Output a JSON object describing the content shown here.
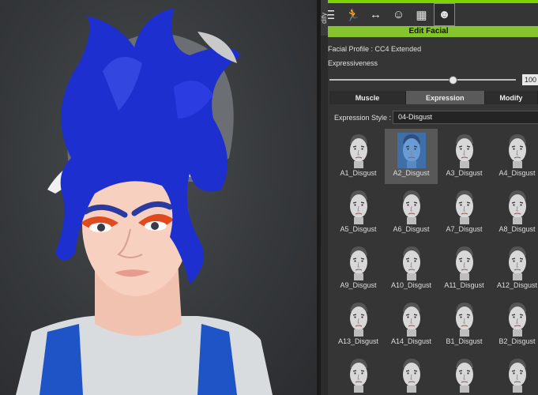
{
  "panel": {
    "side_tab_label": "dify",
    "header_title": "Edit Facial",
    "facial_profile_label": "Facial Profile :",
    "facial_profile_value": "CC4 Extended",
    "expressiveness_label": "Expressiveness",
    "expressiveness_value": "100",
    "expressiveness_level": 0.66,
    "tabs": [
      "Muscle",
      "Expression",
      "Modify"
    ],
    "active_tab": 1,
    "expression_style_label": "Expression Style :",
    "expression_style_value": "04-Disgust",
    "toolbar_icons": [
      "sliders-icon",
      "running-figure-icon",
      "motion-adjust-icon",
      "face-puppet-icon",
      "checker-icon",
      "face-profile-icon"
    ],
    "active_tool": 5,
    "colors": {
      "accent_green": "#86c42d",
      "selected_thumb": "#3e6fa8"
    }
  },
  "expressions": [
    "A1_Disgust",
    "A2_Disgust",
    "A3_Disgust",
    "A4_Disgust",
    "A5_Disgust",
    "A6_Disgust",
    "A7_Disgust",
    "A8_Disgust",
    "A9_Disgust",
    "A10_Disgust",
    "A11_Disgust",
    "A12_Disgust",
    "A13_Disgust",
    "A14_Disgust",
    "B1_Disgust",
    "B2_Disgust",
    "",
    "",
    "",
    ""
  ],
  "selected_expression": 1
}
